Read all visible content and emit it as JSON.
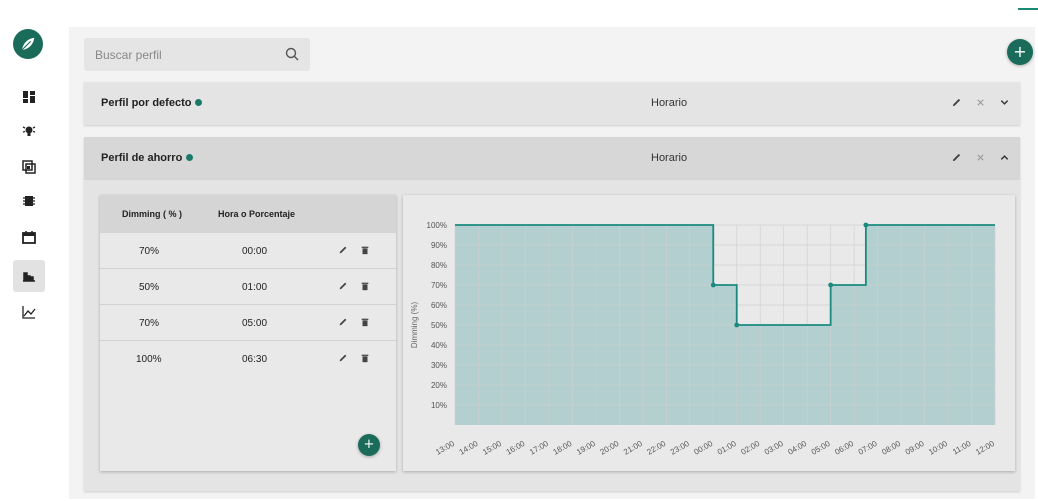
{
  "search": {
    "placeholder": "Buscar perfil"
  },
  "fab_label": "+",
  "colors": {
    "accent": "#1a6b5a",
    "chart_line": "#1a8a80",
    "chart_fill": "#b3cfcf"
  },
  "rail": {
    "icons": [
      "dashboard-icon",
      "lights-icon",
      "schedule-icon",
      "devices-icon",
      "calendar-icon",
      "profiles-icon",
      "stats-icon"
    ],
    "active_index": 5
  },
  "profiles": [
    {
      "name": "Perfil por defecto",
      "type": "Horario",
      "expanded": false
    },
    {
      "name": "Perfil de ahorro",
      "type": "Horario",
      "expanded": true
    }
  ],
  "table": {
    "headers": {
      "dimming": "Dimming ( % )",
      "hora": "Hora o Porcentaje"
    },
    "rows": [
      {
        "dimming": "70%",
        "hora": "00:00"
      },
      {
        "dimming": "50%",
        "hora": "01:00"
      },
      {
        "dimming": "70%",
        "hora": "05:00"
      },
      {
        "dimming": "100%",
        "hora": "06:30"
      }
    ]
  },
  "chart_data": {
    "type": "area",
    "ylabel": "Dimming (%)",
    "xlabel": "",
    "ylim": [
      0,
      100
    ],
    "yticks": [
      "10%",
      "20%",
      "30%",
      "40%",
      "50%",
      "60%",
      "70%",
      "80%",
      "90%",
      "100%"
    ],
    "x": [
      "13:00",
      "14:00",
      "15:00",
      "16:00",
      "17:00",
      "18:00",
      "19:00",
      "20:00",
      "21:00",
      "22:00",
      "23:00",
      "00:00",
      "01:00",
      "02:00",
      "03:00",
      "04:00",
      "05:00",
      "06:00",
      "07:00",
      "08:00",
      "09:00",
      "10:00",
      "11:00",
      "12:00"
    ],
    "series": [
      {
        "steps": [
          {
            "x": "13:00",
            "y": 100
          },
          {
            "x": "00:00",
            "y": 70
          },
          {
            "x": "01:00",
            "y": 50
          },
          {
            "x": "05:00",
            "y": 70
          },
          {
            "x": "06:30",
            "y": 100
          },
          {
            "x": "12:00",
            "y": 100
          }
        ]
      }
    ],
    "grid": true
  }
}
